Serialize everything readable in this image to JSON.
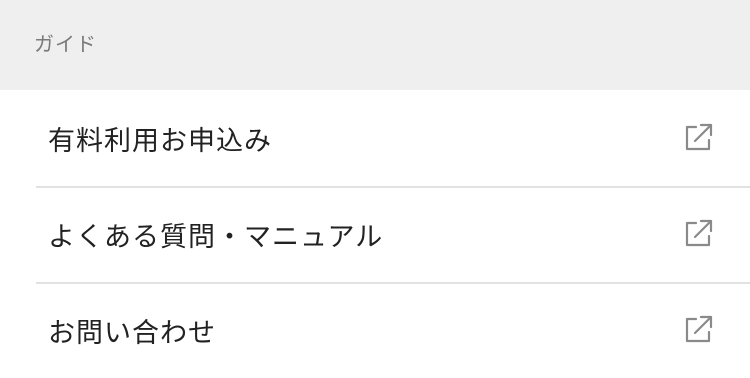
{
  "section": {
    "title": "ガイド"
  },
  "menu": {
    "items": [
      {
        "label": "有料利用お申込み",
        "icon": "external-link-icon"
      },
      {
        "label": "よくある質問・マニュアル",
        "icon": "external-link-icon"
      },
      {
        "label": "お問い合わせ",
        "icon": "external-link-icon"
      }
    ]
  },
  "colors": {
    "header_bg": "#efefef",
    "header_text": "#7a7a7a",
    "item_text": "#222222",
    "divider": "#e2e2e2",
    "icon": "#8a8a8a"
  }
}
